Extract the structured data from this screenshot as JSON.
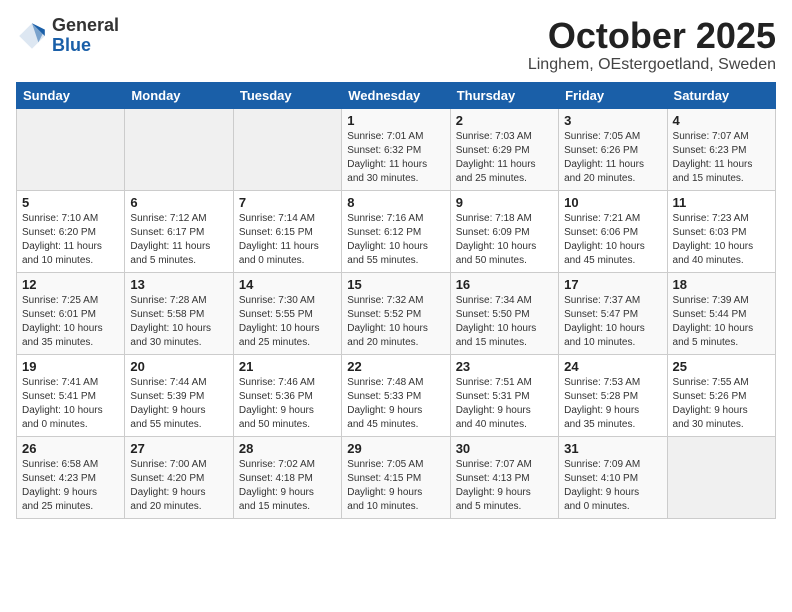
{
  "logo": {
    "general": "General",
    "blue": "Blue"
  },
  "header": {
    "month": "October 2025",
    "location": "Linghem, OEstergoetland, Sweden"
  },
  "weekdays": [
    "Sunday",
    "Monday",
    "Tuesday",
    "Wednesday",
    "Thursday",
    "Friday",
    "Saturday"
  ],
  "weeks": [
    [
      {
        "day": "",
        "info": ""
      },
      {
        "day": "",
        "info": ""
      },
      {
        "day": "",
        "info": ""
      },
      {
        "day": "1",
        "info": "Sunrise: 7:01 AM\nSunset: 6:32 PM\nDaylight: 11 hours\nand 30 minutes."
      },
      {
        "day": "2",
        "info": "Sunrise: 7:03 AM\nSunset: 6:29 PM\nDaylight: 11 hours\nand 25 minutes."
      },
      {
        "day": "3",
        "info": "Sunrise: 7:05 AM\nSunset: 6:26 PM\nDaylight: 11 hours\nand 20 minutes."
      },
      {
        "day": "4",
        "info": "Sunrise: 7:07 AM\nSunset: 6:23 PM\nDaylight: 11 hours\nand 15 minutes."
      }
    ],
    [
      {
        "day": "5",
        "info": "Sunrise: 7:10 AM\nSunset: 6:20 PM\nDaylight: 11 hours\nand 10 minutes."
      },
      {
        "day": "6",
        "info": "Sunrise: 7:12 AM\nSunset: 6:17 PM\nDaylight: 11 hours\nand 5 minutes."
      },
      {
        "day": "7",
        "info": "Sunrise: 7:14 AM\nSunset: 6:15 PM\nDaylight: 11 hours\nand 0 minutes."
      },
      {
        "day": "8",
        "info": "Sunrise: 7:16 AM\nSunset: 6:12 PM\nDaylight: 10 hours\nand 55 minutes."
      },
      {
        "day": "9",
        "info": "Sunrise: 7:18 AM\nSunset: 6:09 PM\nDaylight: 10 hours\nand 50 minutes."
      },
      {
        "day": "10",
        "info": "Sunrise: 7:21 AM\nSunset: 6:06 PM\nDaylight: 10 hours\nand 45 minutes."
      },
      {
        "day": "11",
        "info": "Sunrise: 7:23 AM\nSunset: 6:03 PM\nDaylight: 10 hours\nand 40 minutes."
      }
    ],
    [
      {
        "day": "12",
        "info": "Sunrise: 7:25 AM\nSunset: 6:01 PM\nDaylight: 10 hours\nand 35 minutes."
      },
      {
        "day": "13",
        "info": "Sunrise: 7:28 AM\nSunset: 5:58 PM\nDaylight: 10 hours\nand 30 minutes."
      },
      {
        "day": "14",
        "info": "Sunrise: 7:30 AM\nSunset: 5:55 PM\nDaylight: 10 hours\nand 25 minutes."
      },
      {
        "day": "15",
        "info": "Sunrise: 7:32 AM\nSunset: 5:52 PM\nDaylight: 10 hours\nand 20 minutes."
      },
      {
        "day": "16",
        "info": "Sunrise: 7:34 AM\nSunset: 5:50 PM\nDaylight: 10 hours\nand 15 minutes."
      },
      {
        "day": "17",
        "info": "Sunrise: 7:37 AM\nSunset: 5:47 PM\nDaylight: 10 hours\nand 10 minutes."
      },
      {
        "day": "18",
        "info": "Sunrise: 7:39 AM\nSunset: 5:44 PM\nDaylight: 10 hours\nand 5 minutes."
      }
    ],
    [
      {
        "day": "19",
        "info": "Sunrise: 7:41 AM\nSunset: 5:41 PM\nDaylight: 10 hours\nand 0 minutes."
      },
      {
        "day": "20",
        "info": "Sunrise: 7:44 AM\nSunset: 5:39 PM\nDaylight: 9 hours\nand 55 minutes."
      },
      {
        "day": "21",
        "info": "Sunrise: 7:46 AM\nSunset: 5:36 PM\nDaylight: 9 hours\nand 50 minutes."
      },
      {
        "day": "22",
        "info": "Sunrise: 7:48 AM\nSunset: 5:33 PM\nDaylight: 9 hours\nand 45 minutes."
      },
      {
        "day": "23",
        "info": "Sunrise: 7:51 AM\nSunset: 5:31 PM\nDaylight: 9 hours\nand 40 minutes."
      },
      {
        "day": "24",
        "info": "Sunrise: 7:53 AM\nSunset: 5:28 PM\nDaylight: 9 hours\nand 35 minutes."
      },
      {
        "day": "25",
        "info": "Sunrise: 7:55 AM\nSunset: 5:26 PM\nDaylight: 9 hours\nand 30 minutes."
      }
    ],
    [
      {
        "day": "26",
        "info": "Sunrise: 6:58 AM\nSunset: 4:23 PM\nDaylight: 9 hours\nand 25 minutes."
      },
      {
        "day": "27",
        "info": "Sunrise: 7:00 AM\nSunset: 4:20 PM\nDaylight: 9 hours\nand 20 minutes."
      },
      {
        "day": "28",
        "info": "Sunrise: 7:02 AM\nSunset: 4:18 PM\nDaylight: 9 hours\nand 15 minutes."
      },
      {
        "day": "29",
        "info": "Sunrise: 7:05 AM\nSunset: 4:15 PM\nDaylight: 9 hours\nand 10 minutes."
      },
      {
        "day": "30",
        "info": "Sunrise: 7:07 AM\nSunset: 4:13 PM\nDaylight: 9 hours\nand 5 minutes."
      },
      {
        "day": "31",
        "info": "Sunrise: 7:09 AM\nSunset: 4:10 PM\nDaylight: 9 hours\nand 0 minutes."
      },
      {
        "day": "",
        "info": ""
      }
    ]
  ]
}
